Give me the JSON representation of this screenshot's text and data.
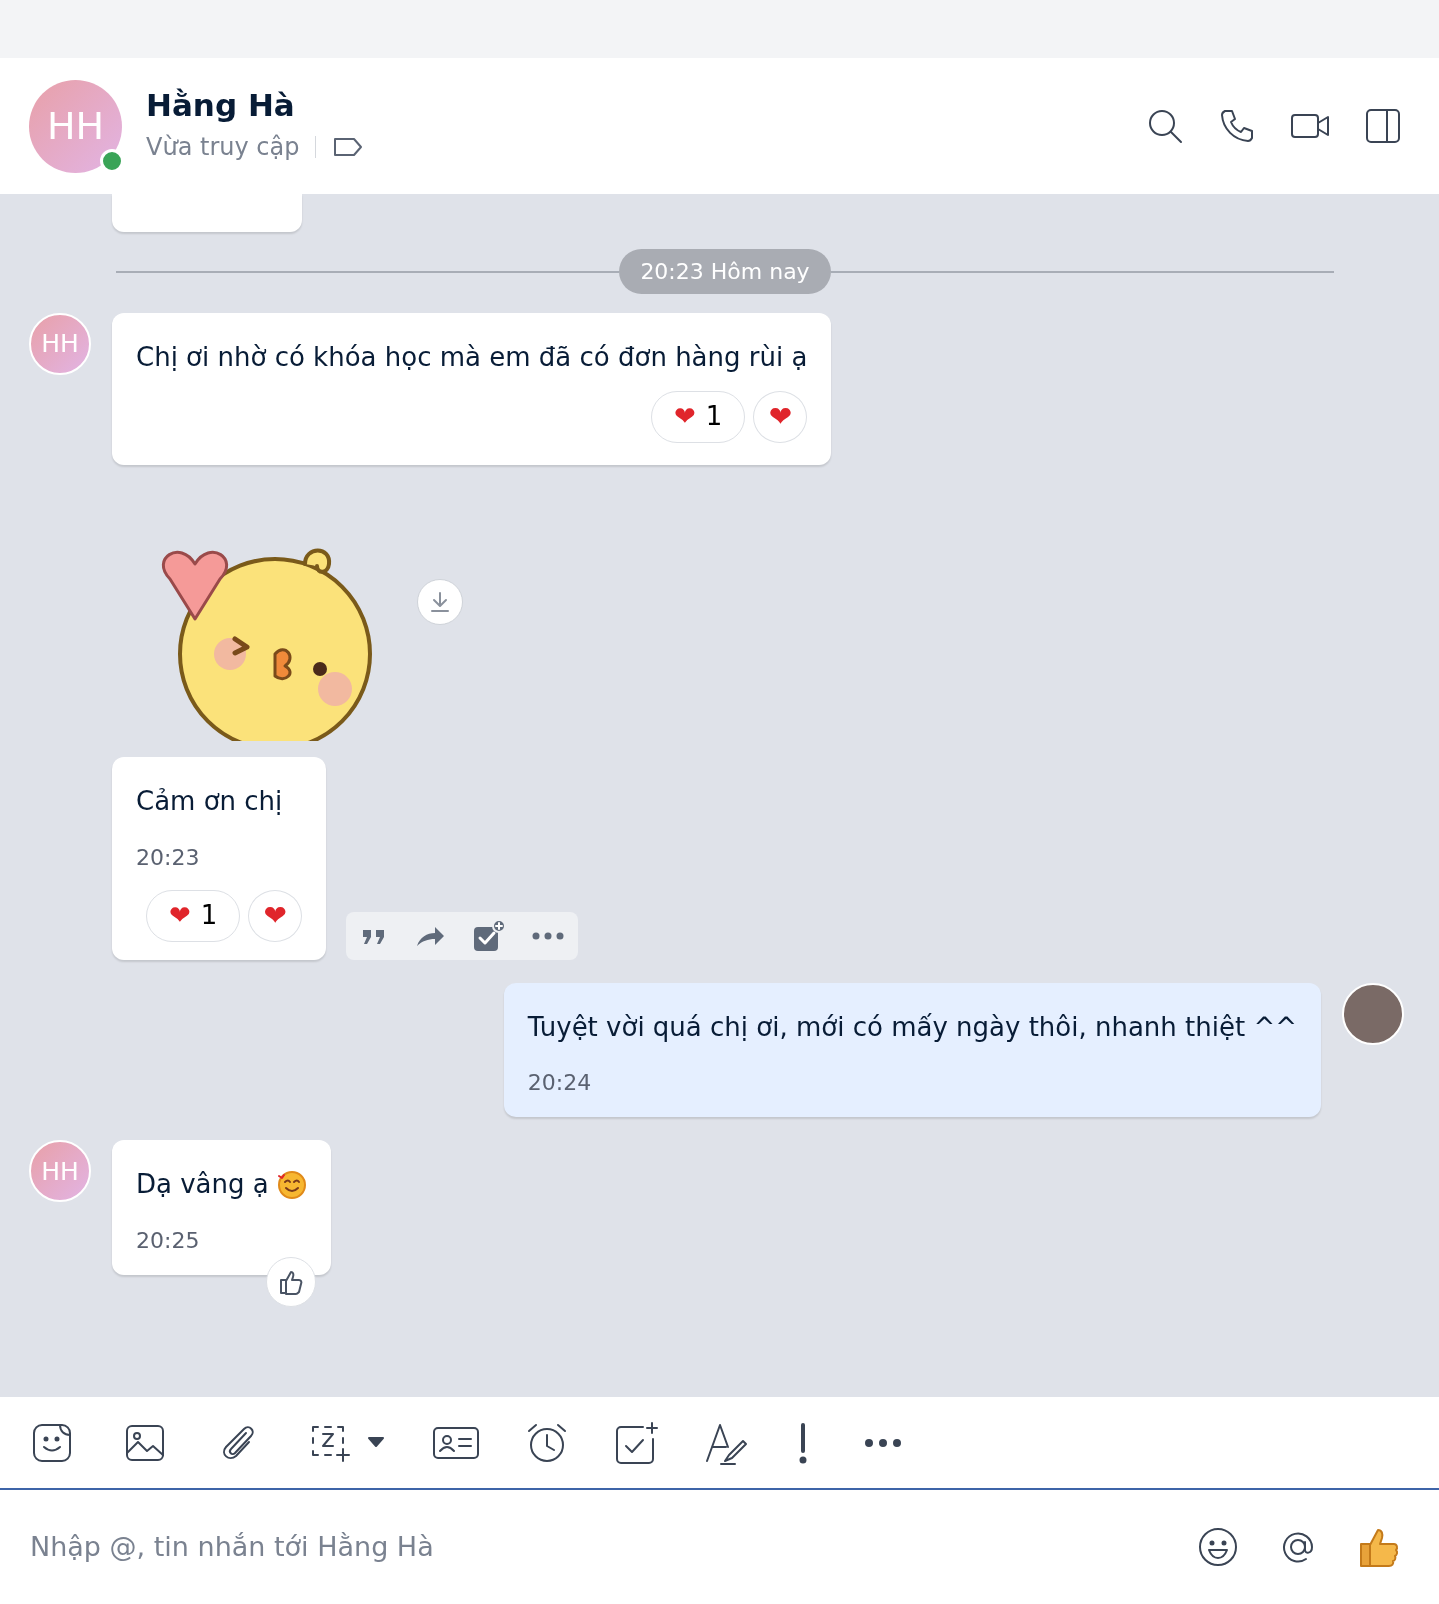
{
  "header": {
    "avatar_initials": "HH",
    "online": true,
    "name": "Hằng Hà",
    "status": "Vừa truy cập"
  },
  "date_divider": "20:23 Hôm nay",
  "messages": [
    {
      "kind": "text",
      "outgoing": false,
      "avatar_initials": "HH",
      "text": "Chị ơi nhờ có khóa học mà em đã có đơn hàng rùi ạ",
      "reaction": {
        "emoji": "❤",
        "count": "1"
      },
      "react_button": "❤"
    },
    {
      "kind": "sticker",
      "outgoing": false
    },
    {
      "kind": "text",
      "outgoing": false,
      "text": "Cảm ơn chị",
      "time": "20:23",
      "reaction": {
        "emoji": "❤",
        "count": "1"
      },
      "react_button": "❤",
      "show_actions": true
    },
    {
      "kind": "text",
      "outgoing": true,
      "text": "Tuyệt vời quá chị ơi, mới có mấy ngày thôi, nhanh thiệt ^^",
      "time": "20:24"
    },
    {
      "kind": "text",
      "outgoing": false,
      "avatar_initials": "HH",
      "text": "Dạ vâng ạ",
      "emoji_icon": true,
      "time": "20:25",
      "like_button": true
    }
  ],
  "composer": {
    "placeholder": "Nhập @, tin nhắn tới Hằng Hà"
  }
}
